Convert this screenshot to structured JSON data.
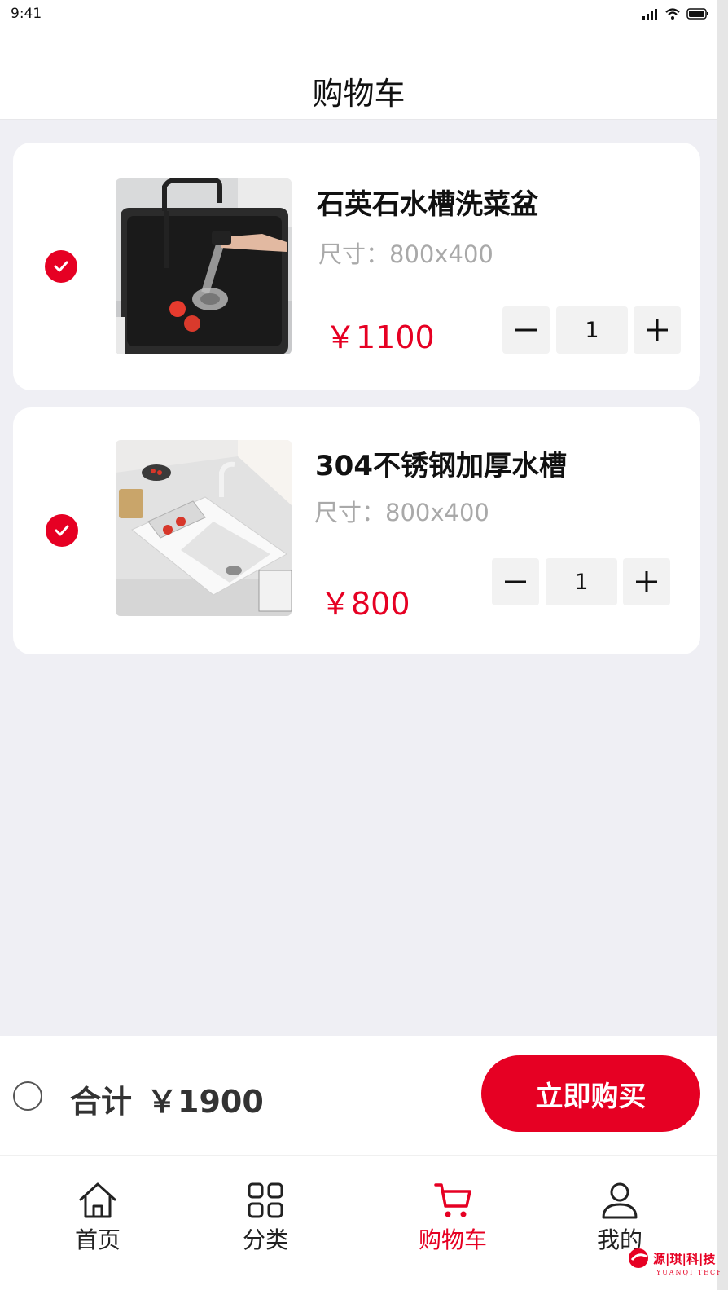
{
  "status": {
    "time": "9:41"
  },
  "header": {
    "title": "购物车"
  },
  "cart": {
    "items": [
      {
        "name": "石英石水槽洗菜盆",
        "size": "尺寸：800x400",
        "price": "￥1100",
        "quantity": "1",
        "selected": true
      },
      {
        "name": "304不锈钢加厚水槽",
        "size": "尺寸：800x400",
        "price": "￥800",
        "quantity": "1",
        "selected": true
      }
    ]
  },
  "checkout": {
    "total_label": "合计",
    "total_value": "￥1900",
    "buy_label": "立即购买",
    "select_all": false
  },
  "tabbar": {
    "tabs": [
      {
        "label": "首页",
        "icon": "home-icon",
        "active": false
      },
      {
        "label": "分类",
        "icon": "grid-icon",
        "active": false
      },
      {
        "label": "购物车",
        "icon": "cart-icon",
        "active": true
      },
      {
        "label": "我的",
        "icon": "user-icon",
        "active": false
      }
    ]
  },
  "watermark": {
    "text": "源琪科技",
    "subtext": "YUANQI TECH"
  },
  "colors": {
    "accent": "#e60023",
    "background": "#efeff4",
    "text": "#111111",
    "muted": "#a9a9a9"
  }
}
